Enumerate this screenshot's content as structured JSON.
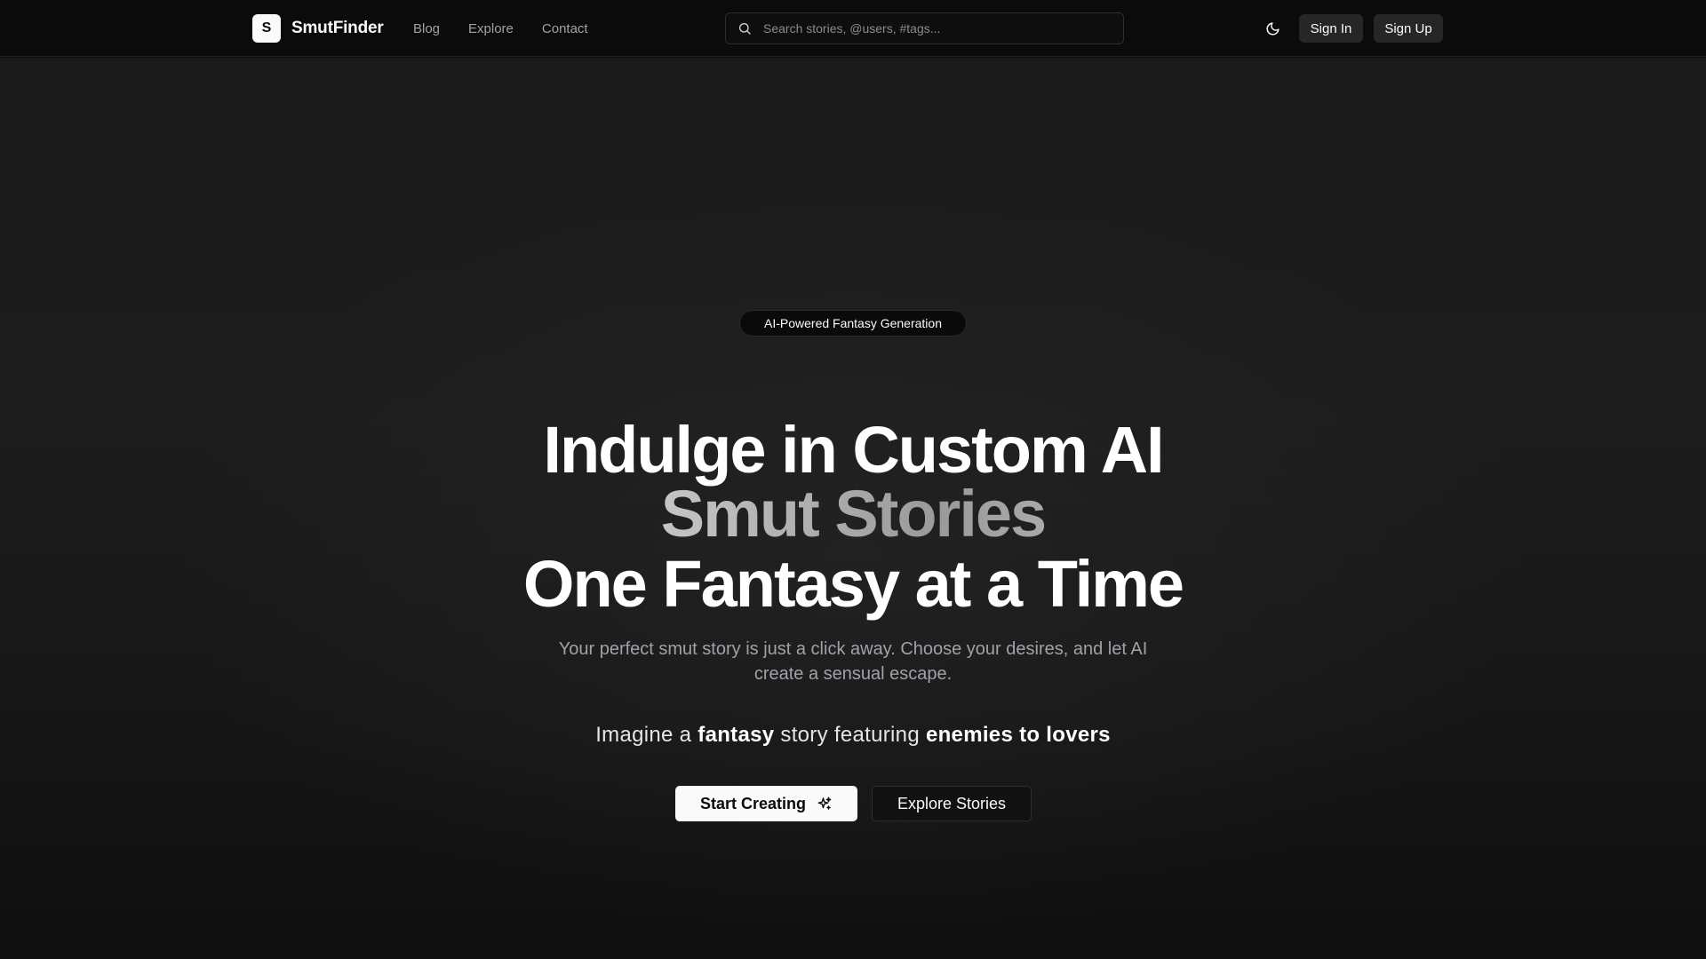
{
  "header": {
    "logo_letter": "S",
    "brand_name": "SmutFinder",
    "nav": [
      {
        "label": "Blog"
      },
      {
        "label": "Explore"
      },
      {
        "label": "Contact"
      }
    ],
    "search": {
      "placeholder": "Search stories, @users, #tags...",
      "icon": "search-icon"
    },
    "theme_toggle_icon": "moon-icon",
    "sign_in": "Sign In",
    "sign_up": "Sign Up"
  },
  "hero": {
    "badge": "AI-Powered Fantasy Generation",
    "headline_line1": "Indulge in Custom AI",
    "headline_line2": "Smut Stories",
    "headline_line3": "One Fantasy at a Time",
    "subtitle": "Your perfect smut story is just a click away. Choose your desires, and let AI create a sensual escape.",
    "imagine": {
      "prefix": "Imagine a",
      "genre": "fantasy",
      "middle": "story featuring",
      "trope": "enemies to lovers"
    },
    "primary_button": "Start Creating",
    "primary_button_icon": "sparkles-icon",
    "secondary_button": "Explore Stories"
  },
  "colors": {
    "background": "#0d0d0d",
    "hero_gradient": "#1c1c1c",
    "text_primary": "#fafafa",
    "text_muted": "#a1a1aa",
    "button_dark": "#262626"
  }
}
